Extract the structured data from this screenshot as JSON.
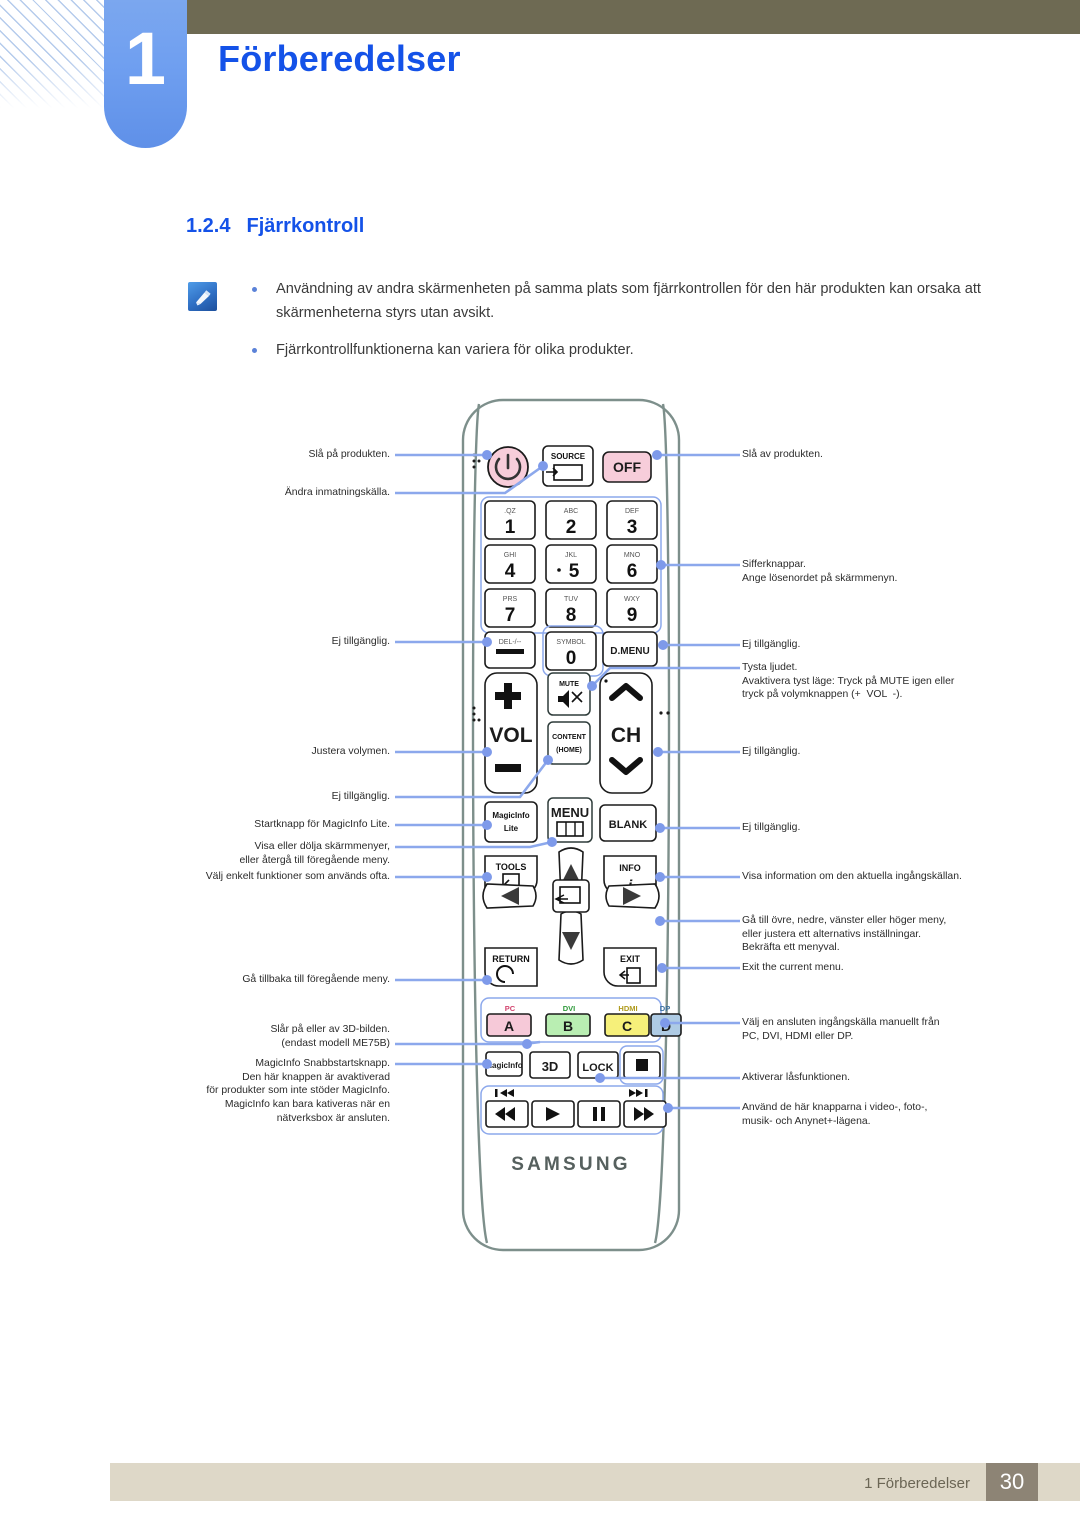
{
  "header": {
    "chapter_number": "1",
    "chapter_title": "Förberedelser"
  },
  "section": {
    "number": "1.2.4",
    "title": "Fjärrkontroll"
  },
  "notes": {
    "icon": "note-pencil-icon",
    "items": [
      "Användning av andra skärmenheten på samma plats som fjärrkontrollen för den här produkten kan orsaka att skärmenheterna styrs utan avsikt.",
      "Fjärrkontrollfunktionerna kan variera för olika produkter."
    ]
  },
  "remote": {
    "brand": "SAMSUNG",
    "buttons": {
      "power": "power-icon",
      "source_label": "SOURCE",
      "off": "OFF",
      "numbers": [
        {
          "sub": ".QZ",
          "digit": "1"
        },
        {
          "sub": "ABC",
          "digit": "2"
        },
        {
          "sub": "DEF",
          "digit": "3"
        },
        {
          "sub": "GHI",
          "digit": "4"
        },
        {
          "sub": "JKL",
          "digit": "5"
        },
        {
          "sub": "MNO",
          "digit": "6"
        },
        {
          "sub": "PRS",
          "digit": "7"
        },
        {
          "sub": "TUV",
          "digit": "8"
        },
        {
          "sub": "WXY",
          "digit": "9"
        }
      ],
      "del": "DEL-/--",
      "symbol_sub": "SYMBOL",
      "zero": "0",
      "dmenu": "D.MENU",
      "mute": "MUTE",
      "vol": "VOL",
      "ch": "CH",
      "content_home_line1": "CONTENT",
      "content_home_line2": "(HOME)",
      "magicinfo_lite_line1": "MagicInfo",
      "magicinfo_lite_line2": "Lite",
      "menu": "MENU",
      "blank": "BLANK",
      "tools": "TOOLS",
      "info": "INFO",
      "return": "RETURN",
      "exit": "EXIT",
      "color_keys": [
        {
          "top": "PC",
          "letter": "A",
          "color": "#f6c9d8"
        },
        {
          "top": "DVI",
          "letter": "B",
          "color": "#b9eeb2"
        },
        {
          "top": "HDMI",
          "letter": "C",
          "color": "#f6f07a"
        },
        {
          "top": "DP",
          "letter": "D",
          "color": "#aecbe4"
        }
      ],
      "magicinfo": "MagicInfo",
      "three_d": "3D",
      "lock": "LOCK",
      "stop": "stop-icon",
      "media": [
        "rewind-icon",
        "play-icon",
        "pause-icon",
        "fast-forward-icon"
      ],
      "media_prev_mark": "skip-previous-icon",
      "media_next_mark": "skip-next-icon"
    }
  },
  "callouts": {
    "left": [
      "Slå på produkten.",
      "Ändra inmatningskälla.",
      "Ej tillgänglig.",
      "Justera volymen.",
      "Ej tillgänglig.",
      "Startknapp för MagicInfo Lite.",
      "Visa eller dölja skärmmenyer,\neller återgå till föregående meny.",
      "Välj enkelt funktioner som används ofta.",
      "Gå tillbaka till föregående meny.",
      "Slår på eller av 3D-bilden.\n(endast modell ME75B)",
      "MagicInfo Snabbstartsknapp.\nDen här knappen är avaktiverad\nför produkter som inte stöder MagicInfo.\nMagicInfo kan bara kativeras när en\nnätverksbox är ansluten."
    ],
    "right": [
      "Slå av produkten.",
      "Sifferknappar.\nAnge lösenordet på skärmmenyn.",
      "Ej tillgänglig.",
      "Tysta ljudet.\nAvaktivera tyst läge: Tryck på MUTE igen eller\ntryck på volymknappen (+  VOL  -).",
      "Ej tillgänglig.",
      "Ej tillgänglig.",
      "Visa information om den aktuella ingångskällan.",
      "Gå till övre, nedre, vänster eller höger meny,\neller justera ett alternativs inställningar.\nBekräfta ett menyval.",
      "Exit the current menu.",
      "Välj en ansluten ingångskälla manuellt från\nPC, DVI, HDMI eller DP.",
      "Aktiverar låsfunktionen.",
      "Använd de här knapparna i video-, foto-,\nmusik- och Anynet+-lägena."
    ]
  },
  "footer": {
    "text": "1 Förberedelser",
    "page": "30"
  },
  "colors": {
    "accent_blue": "#1452e8",
    "tab_blue": "#6f9ff0",
    "olive": "#6e6a53",
    "footer_band": "#ded8c8",
    "page_badge": "#8d8475",
    "leader": "#8ca8ec",
    "remote_body": "#7d8f8b"
  }
}
